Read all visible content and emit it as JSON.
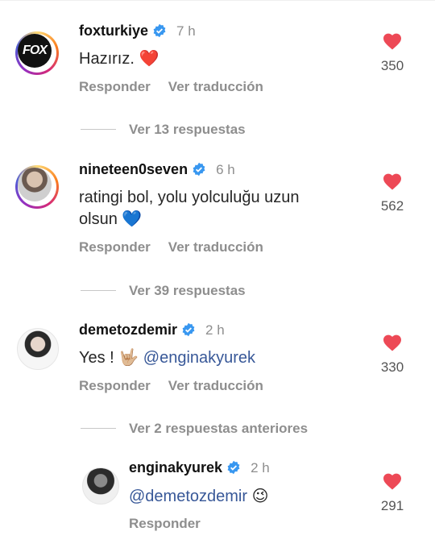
{
  "comments": [
    {
      "username": "foxturkiye",
      "time": "7 h",
      "text": "Hazırız.",
      "emoji": "❤️",
      "likes": "350",
      "reply_label": "Responder",
      "translate_label": "Ver traducción",
      "avatar": "fox-logo",
      "view_replies": "Ver 13 respuestas"
    },
    {
      "username": "nineteen0seven",
      "time": "6 h",
      "text_line1": "ratingi bol, yolu yolculuğu uzun",
      "text_line2": "olsun",
      "emoji": "💙",
      "likes": "562",
      "reply_label": "Responder",
      "translate_label": "Ver traducción",
      "avatar": "man-portrait",
      "view_replies": "Ver 39 respuestas"
    },
    {
      "username": "demetozdemir",
      "time": "2 h",
      "text": "Yes !",
      "emoji": "🤟🏼",
      "mention": "@enginakyurek",
      "likes": "330",
      "reply_label": "Responder",
      "translate_label": "Ver traducción",
      "avatar": "woman-portrait",
      "view_replies": "Ver 2 respuestas anteriores"
    }
  ],
  "reply": {
    "username": "enginakyurek",
    "time": "2 h",
    "mention": "@demetozdemir",
    "emoji": "😉",
    "likes": "291",
    "reply_label": "Responder",
    "avatar": "man-portrait-bw"
  },
  "colors": {
    "verified": "#3897f0",
    "heart": "#ed4956",
    "mention": "#385898",
    "muted": "#8e8e8e"
  }
}
